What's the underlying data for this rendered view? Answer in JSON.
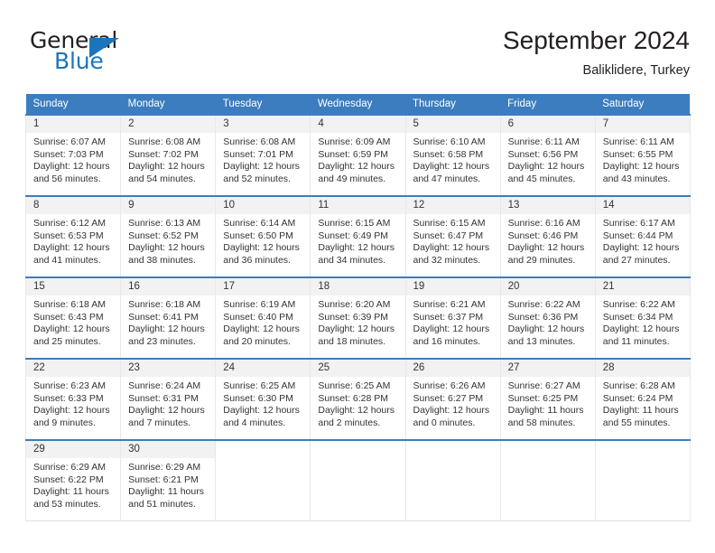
{
  "brand": {
    "name_top": "General",
    "name_bottom": "Blue",
    "color_dark": "#231f20",
    "color_blue": "#1b75bc"
  },
  "header": {
    "month_title": "September 2024",
    "location": "Baliklidere, Turkey"
  },
  "theme": {
    "header_row_bg": "#3c7dbf",
    "daynum_bg": "#f2f2f2",
    "cell_border": "#e8e8e8"
  },
  "weekday_headers": [
    "Sunday",
    "Monday",
    "Tuesday",
    "Wednesday",
    "Thursday",
    "Friday",
    "Saturday"
  ],
  "weeks": [
    [
      {
        "day": "1",
        "sunrise": "Sunrise: 6:07 AM",
        "sunset": "Sunset: 7:03 PM",
        "daylight1": "Daylight: 12 hours",
        "daylight2": "and 56 minutes."
      },
      {
        "day": "2",
        "sunrise": "Sunrise: 6:08 AM",
        "sunset": "Sunset: 7:02 PM",
        "daylight1": "Daylight: 12 hours",
        "daylight2": "and 54 minutes."
      },
      {
        "day": "3",
        "sunrise": "Sunrise: 6:08 AM",
        "sunset": "Sunset: 7:01 PM",
        "daylight1": "Daylight: 12 hours",
        "daylight2": "and 52 minutes."
      },
      {
        "day": "4",
        "sunrise": "Sunrise: 6:09 AM",
        "sunset": "Sunset: 6:59 PM",
        "daylight1": "Daylight: 12 hours",
        "daylight2": "and 49 minutes."
      },
      {
        "day": "5",
        "sunrise": "Sunrise: 6:10 AM",
        "sunset": "Sunset: 6:58 PM",
        "daylight1": "Daylight: 12 hours",
        "daylight2": "and 47 minutes."
      },
      {
        "day": "6",
        "sunrise": "Sunrise: 6:11 AM",
        "sunset": "Sunset: 6:56 PM",
        "daylight1": "Daylight: 12 hours",
        "daylight2": "and 45 minutes."
      },
      {
        "day": "7",
        "sunrise": "Sunrise: 6:11 AM",
        "sunset": "Sunset: 6:55 PM",
        "daylight1": "Daylight: 12 hours",
        "daylight2": "and 43 minutes."
      }
    ],
    [
      {
        "day": "8",
        "sunrise": "Sunrise: 6:12 AM",
        "sunset": "Sunset: 6:53 PM",
        "daylight1": "Daylight: 12 hours",
        "daylight2": "and 41 minutes."
      },
      {
        "day": "9",
        "sunrise": "Sunrise: 6:13 AM",
        "sunset": "Sunset: 6:52 PM",
        "daylight1": "Daylight: 12 hours",
        "daylight2": "and 38 minutes."
      },
      {
        "day": "10",
        "sunrise": "Sunrise: 6:14 AM",
        "sunset": "Sunset: 6:50 PM",
        "daylight1": "Daylight: 12 hours",
        "daylight2": "and 36 minutes."
      },
      {
        "day": "11",
        "sunrise": "Sunrise: 6:15 AM",
        "sunset": "Sunset: 6:49 PM",
        "daylight1": "Daylight: 12 hours",
        "daylight2": "and 34 minutes."
      },
      {
        "day": "12",
        "sunrise": "Sunrise: 6:15 AM",
        "sunset": "Sunset: 6:47 PM",
        "daylight1": "Daylight: 12 hours",
        "daylight2": "and 32 minutes."
      },
      {
        "day": "13",
        "sunrise": "Sunrise: 6:16 AM",
        "sunset": "Sunset: 6:46 PM",
        "daylight1": "Daylight: 12 hours",
        "daylight2": "and 29 minutes."
      },
      {
        "day": "14",
        "sunrise": "Sunrise: 6:17 AM",
        "sunset": "Sunset: 6:44 PM",
        "daylight1": "Daylight: 12 hours",
        "daylight2": "and 27 minutes."
      }
    ],
    [
      {
        "day": "15",
        "sunrise": "Sunrise: 6:18 AM",
        "sunset": "Sunset: 6:43 PM",
        "daylight1": "Daylight: 12 hours",
        "daylight2": "and 25 minutes."
      },
      {
        "day": "16",
        "sunrise": "Sunrise: 6:18 AM",
        "sunset": "Sunset: 6:41 PM",
        "daylight1": "Daylight: 12 hours",
        "daylight2": "and 23 minutes."
      },
      {
        "day": "17",
        "sunrise": "Sunrise: 6:19 AM",
        "sunset": "Sunset: 6:40 PM",
        "daylight1": "Daylight: 12 hours",
        "daylight2": "and 20 minutes."
      },
      {
        "day": "18",
        "sunrise": "Sunrise: 6:20 AM",
        "sunset": "Sunset: 6:39 PM",
        "daylight1": "Daylight: 12 hours",
        "daylight2": "and 18 minutes."
      },
      {
        "day": "19",
        "sunrise": "Sunrise: 6:21 AM",
        "sunset": "Sunset: 6:37 PM",
        "daylight1": "Daylight: 12 hours",
        "daylight2": "and 16 minutes."
      },
      {
        "day": "20",
        "sunrise": "Sunrise: 6:22 AM",
        "sunset": "Sunset: 6:36 PM",
        "daylight1": "Daylight: 12 hours",
        "daylight2": "and 13 minutes."
      },
      {
        "day": "21",
        "sunrise": "Sunrise: 6:22 AM",
        "sunset": "Sunset: 6:34 PM",
        "daylight1": "Daylight: 12 hours",
        "daylight2": "and 11 minutes."
      }
    ],
    [
      {
        "day": "22",
        "sunrise": "Sunrise: 6:23 AM",
        "sunset": "Sunset: 6:33 PM",
        "daylight1": "Daylight: 12 hours",
        "daylight2": "and 9 minutes."
      },
      {
        "day": "23",
        "sunrise": "Sunrise: 6:24 AM",
        "sunset": "Sunset: 6:31 PM",
        "daylight1": "Daylight: 12 hours",
        "daylight2": "and 7 minutes."
      },
      {
        "day": "24",
        "sunrise": "Sunrise: 6:25 AM",
        "sunset": "Sunset: 6:30 PM",
        "daylight1": "Daylight: 12 hours",
        "daylight2": "and 4 minutes."
      },
      {
        "day": "25",
        "sunrise": "Sunrise: 6:25 AM",
        "sunset": "Sunset: 6:28 PM",
        "daylight1": "Daylight: 12 hours",
        "daylight2": "and 2 minutes."
      },
      {
        "day": "26",
        "sunrise": "Sunrise: 6:26 AM",
        "sunset": "Sunset: 6:27 PM",
        "daylight1": "Daylight: 12 hours",
        "daylight2": "and 0 minutes."
      },
      {
        "day": "27",
        "sunrise": "Sunrise: 6:27 AM",
        "sunset": "Sunset: 6:25 PM",
        "daylight1": "Daylight: 11 hours",
        "daylight2": "and 58 minutes."
      },
      {
        "day": "28",
        "sunrise": "Sunrise: 6:28 AM",
        "sunset": "Sunset: 6:24 PM",
        "daylight1": "Daylight: 11 hours",
        "daylight2": "and 55 minutes."
      }
    ],
    [
      {
        "day": "29",
        "sunrise": "Sunrise: 6:29 AM",
        "sunset": "Sunset: 6:22 PM",
        "daylight1": "Daylight: 11 hours",
        "daylight2": "and 53 minutes."
      },
      {
        "day": "30",
        "sunrise": "Sunrise: 6:29 AM",
        "sunset": "Sunset: 6:21 PM",
        "daylight1": "Daylight: 11 hours",
        "daylight2": "and 51 minutes."
      },
      {
        "day": "",
        "sunrise": "",
        "sunset": "",
        "daylight1": "",
        "daylight2": ""
      },
      {
        "day": "",
        "sunrise": "",
        "sunset": "",
        "daylight1": "",
        "daylight2": ""
      },
      {
        "day": "",
        "sunrise": "",
        "sunset": "",
        "daylight1": "",
        "daylight2": ""
      },
      {
        "day": "",
        "sunrise": "",
        "sunset": "",
        "daylight1": "",
        "daylight2": ""
      },
      {
        "day": "",
        "sunrise": "",
        "sunset": "",
        "daylight1": "",
        "daylight2": ""
      }
    ]
  ]
}
